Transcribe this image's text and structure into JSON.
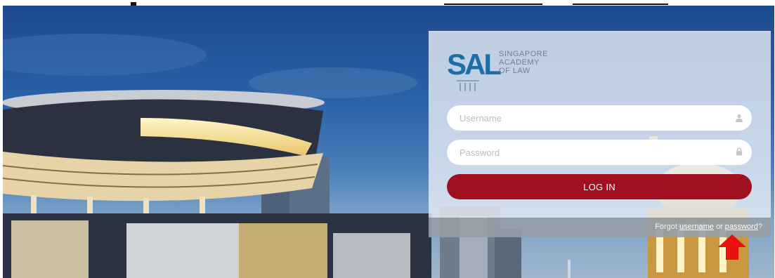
{
  "logo": {
    "mark": "SAL",
    "lines": [
      "SINGAPORE",
      "ACADEMY",
      "OF LAW"
    ]
  },
  "form": {
    "username_placeholder": "Username",
    "password_placeholder": "Password",
    "login_label": "LOG IN"
  },
  "forgot": {
    "prefix": "Forgot",
    "username_link": "username",
    "middle": "or",
    "password_link": "password",
    "suffix": "?"
  },
  "icons": {
    "username_field": "user-icon",
    "password_field": "lock-icon",
    "annotation": "red-arrow-icon"
  },
  "colors": {
    "login_button": "#a01020",
    "logo_blue": "#1c6fa6",
    "annotation_arrow": "#e8120c"
  }
}
